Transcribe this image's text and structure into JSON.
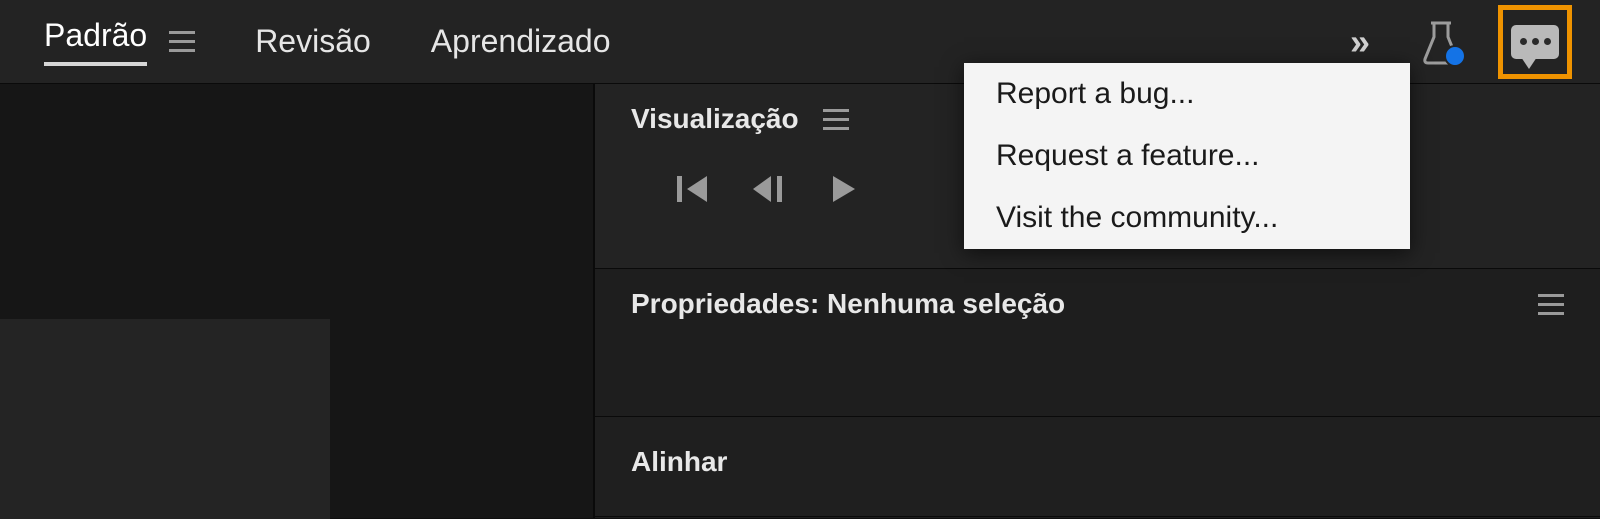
{
  "workspaces": {
    "active": "Padrão",
    "items": [
      "Padrão",
      "Revisão",
      "Aprendizado"
    ]
  },
  "panels": {
    "visualization": {
      "title": "Visualização"
    },
    "properties": {
      "title": "Propriedades: Nenhuma seleção"
    },
    "align": {
      "title": "Alinhar"
    }
  },
  "feedback_menu": {
    "items": [
      "Report a bug...",
      "Request a feature...",
      "Visit the community..."
    ]
  },
  "colors": {
    "highlight": "#ef9300",
    "accent_dot": "#1473e6"
  }
}
